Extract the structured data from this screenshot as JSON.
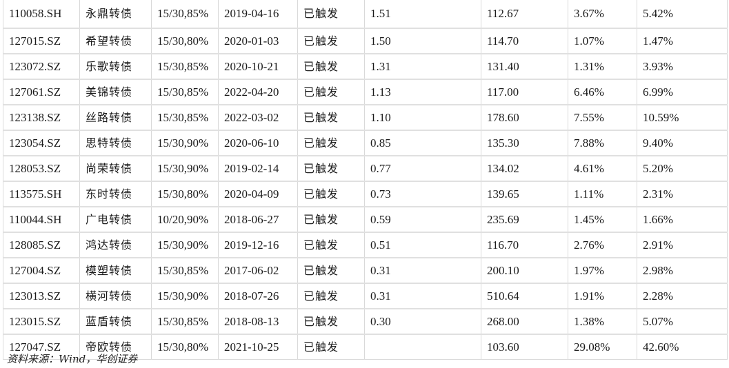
{
  "table": {
    "rows": [
      [
        "110058.SH",
        "永鼎转债",
        "15/30,85%",
        "2019-04-16",
        "已触发",
        "1.51",
        "",
        "112.67",
        "3.67%",
        "5.42%"
      ],
      [
        "127015.SZ",
        "希望转债",
        "15/30,80%",
        "2020-01-03",
        "已触发",
        "1.50",
        "",
        "114.70",
        "1.07%",
        "1.47%"
      ],
      [
        "123072.SZ",
        "乐歌转债",
        "15/30,85%",
        "2020-10-21",
        "已触发",
        "1.31",
        "",
        "131.40",
        "1.31%",
        "3.93%"
      ],
      [
        "127061.SZ",
        "美锦转债",
        "15/30,85%",
        "2022-04-20",
        "已触发",
        "1.13",
        "",
        "117.00",
        "6.46%",
        "6.99%"
      ],
      [
        "123138.SZ",
        "丝路转债",
        "15/30,85%",
        "2022-03-02",
        "已触发",
        "1.10",
        "",
        "178.60",
        "7.55%",
        "10.59%"
      ],
      [
        "123054.SZ",
        "思特转债",
        "15/30,90%",
        "2020-06-10",
        "已触发",
        "0.85",
        "",
        "135.30",
        "7.88%",
        "9.40%"
      ],
      [
        "128053.SZ",
        "尚荣转债",
        "15/30,90%",
        "2019-02-14",
        "已触发",
        "0.77",
        "",
        "134.02",
        "4.61%",
        "5.20%"
      ],
      [
        "113575.SH",
        "东时转债",
        "15/30,80%",
        "2020-04-09",
        "已触发",
        "0.73",
        "",
        "139.65",
        "1.11%",
        "2.31%"
      ],
      [
        "110044.SH",
        "广电转债",
        "10/20,90%",
        "2018-06-27",
        "已触发",
        "0.59",
        "",
        "235.69",
        "1.45%",
        "1.66%"
      ],
      [
        "128085.SZ",
        "鸿达转债",
        "15/30,90%",
        "2019-12-16",
        "已触发",
        "0.51",
        "",
        "116.70",
        "2.76%",
        "2.91%"
      ],
      [
        "127004.SZ",
        "模塑转债",
        "15/30,85%",
        "2017-06-02",
        "已触发",
        "0.31",
        "",
        "200.10",
        "1.97%",
        "2.98%"
      ],
      [
        "123013.SZ",
        "横河转债",
        "15/30,90%",
        "2018-07-26",
        "已触发",
        "0.31",
        "",
        "510.64",
        "1.91%",
        "2.28%"
      ],
      [
        "123015.SZ",
        "蓝盾转债",
        "15/30,85%",
        "2018-08-13",
        "已触发",
        "0.30",
        "",
        "268.00",
        "1.38%",
        "5.07%"
      ],
      [
        "127047.SZ",
        "帝欧转债",
        "15/30,80%",
        "2021-10-25",
        "已触发",
        "",
        "",
        "103.60",
        "29.08%",
        "42.60%"
      ]
    ]
  },
  "source": "资料来源：Wind，华创证券"
}
